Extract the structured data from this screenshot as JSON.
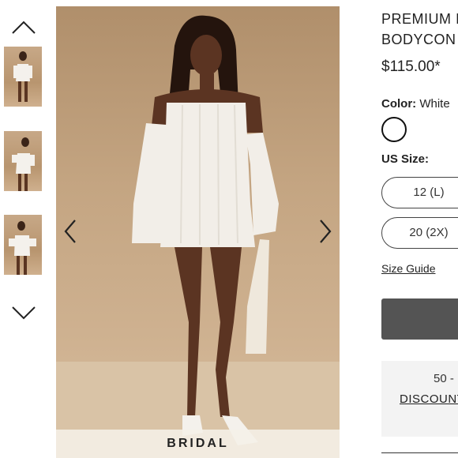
{
  "gallery": {
    "up_icon": "chevron-up-icon",
    "down_icon": "chevron-down-icon",
    "prev_icon": "chevron-left-icon",
    "next_icon": "chevron-right-icon",
    "badge_text": "BRIDAL",
    "thumbnail_count": 3
  },
  "product": {
    "title_line1": "PREMIUM I",
    "title_line2": "BODYCON",
    "price": "$115.00*",
    "color_label": "Color:",
    "color_value": "White",
    "swatch_color": "#ffffff",
    "size_label": "US Size:",
    "sizes": [
      "12 (L)",
      "20 (2X)"
    ],
    "size_guide": "Size Guide"
  },
  "promo": {
    "line1": "50 -",
    "line2": "DISCOUNT"
  },
  "colors": {
    "add_button": "#545454",
    "promo_bg": "#f3f3f3",
    "photo_backdrop": "#c4a582"
  }
}
